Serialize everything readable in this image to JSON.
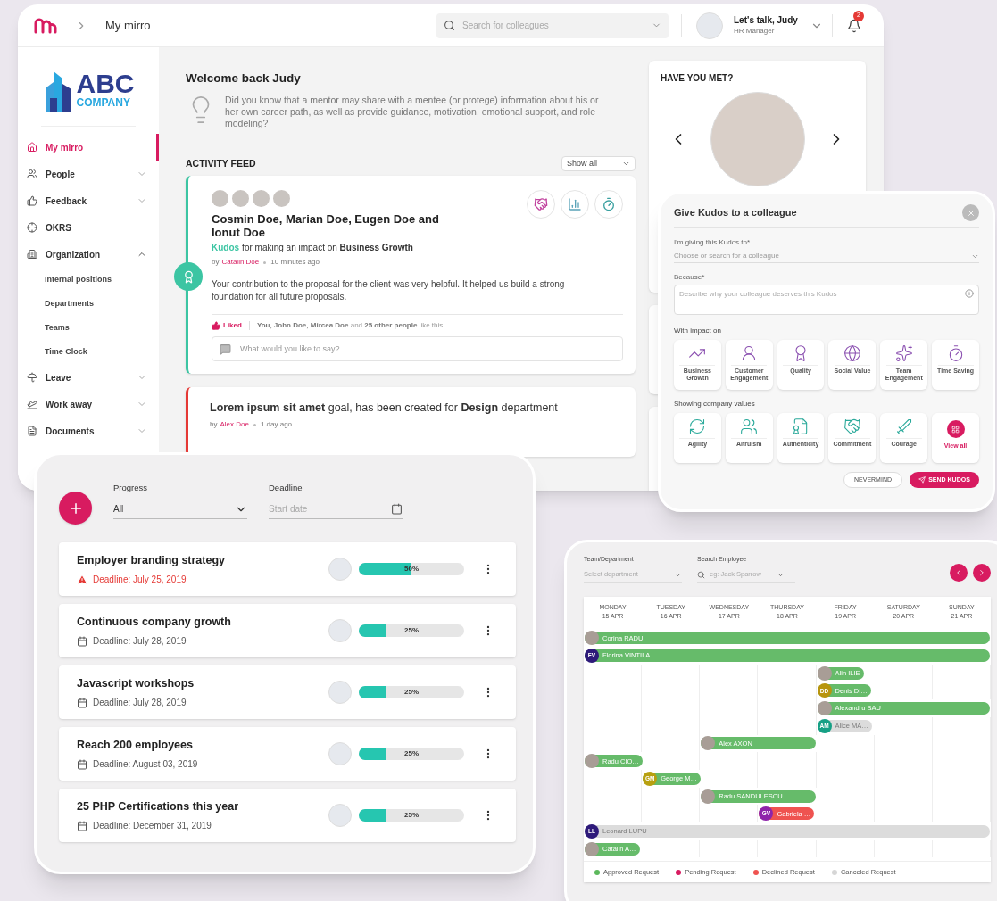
{
  "main_window": {
    "topbar": {
      "breadcrumb": "My mirro",
      "search": {
        "placeholder": "Search for colleagues"
      },
      "user": {
        "name": "Let's talk, Judy",
        "role": "HR Manager"
      },
      "notifications": "2"
    },
    "sidebar": {
      "logo": {
        "name": "ABC",
        "sub": "COMPANY"
      },
      "items": [
        {
          "label": "My mirro",
          "selected": true
        },
        {
          "label": "People",
          "selected": false,
          "expanded": false
        },
        {
          "label": "Feedback",
          "selected": false,
          "expanded": false
        },
        {
          "label": "OKRS",
          "selected": false
        },
        {
          "label": "Organization",
          "selected": false,
          "expanded": true,
          "children": [
            {
              "label": "Internal positions",
              "selected": false
            },
            {
              "label": "Departments",
              "selected": false
            },
            {
              "label": "Teams",
              "selected": false
            },
            {
              "label": "Time Clock",
              "selected": false
            }
          ]
        },
        {
          "label": "Leave",
          "selected": false,
          "expanded": false
        },
        {
          "label": "Work away",
          "selected": false,
          "expanded": false
        },
        {
          "label": "Documents",
          "selected": false,
          "expanded": false
        }
      ]
    },
    "welcome": {
      "title": "Welcome back Judy",
      "tip": "Did you know that a mentor may share with a mentee (or protege) information about his or her own career path, as well as provide guidance, motivation, emotional support, and role modeling?"
    },
    "feed": {
      "title": "ACTIVITY FEED",
      "filter": "Show all",
      "posts": [
        {
          "kind": "kudos",
          "people": "Cosmin Doe, Marian Doe, Eugen Doe and Ionut Doe",
          "tag": "Kudos",
          "text": "for making an impact on **Business Growth**",
          "by": "by",
          "author": "Catalin Doe",
          "time": "10 minutes ago",
          "message": "Your contribution to the proposal for the client was very helpful. It helped us build a strong foundation for all future proposals.",
          "liked": true,
          "like_label": "Liked",
          "likes": "**You, John Doe, Mircea Doe** and **25 other people** like this",
          "comment_placeholder": "What would you like to say?"
        },
        {
          "kind": "goal",
          "title": "**Lorem ipsum sit amet** goal, has been created for **Design** department",
          "by": "by",
          "author": "Alex Doe",
          "time": "1 day ago"
        }
      ]
    },
    "have_you_met": {
      "title": "HAVE YOU MET?"
    }
  },
  "kudos_dialog": {
    "title": "Give Kudos to a colleague",
    "recipient": {
      "label": "I'm giving this Kudos to*",
      "placeholder": "Choose or search for a colleague"
    },
    "reason": {
      "label": "Because*",
      "placeholder": "Describe why your colleague deserves this Kudos"
    },
    "impact_title": "With impact on",
    "impacts": [
      "Business Growth",
      "Customer Engagement",
      "Quality",
      "Social Value",
      "Team Engagement",
      "Time Saving"
    ],
    "values_title": "Showing company values",
    "values": [
      "Agility",
      "Altruism",
      "Authenticity",
      "Commitment",
      "Courage"
    ],
    "view_all": "View all",
    "cancel": "NEVERMIND",
    "send": "SEND KUDOS"
  },
  "goals_panel": {
    "progress_filter": {
      "label": "Progress",
      "value": "All"
    },
    "deadline_filter": {
      "label": "Deadline",
      "placeholder": "Start date"
    },
    "goals": [
      {
        "title": "Employer branding strategy",
        "deadline": "Deadline: July 25, 2019",
        "overdue": true,
        "level": 0.5,
        "reading": "50%"
      },
      {
        "title": "Continuous company growth",
        "deadline": "Deadline: July 28, 2019",
        "overdue": false,
        "level": 0.25,
        "reading": "25%"
      },
      {
        "title": "Javascript workshops",
        "deadline": "Deadline: July 28, 2019",
        "overdue": false,
        "level": 0.25,
        "reading": "25%"
      },
      {
        "title": "Reach 200 employees",
        "deadline": "Deadline: August 03, 2019",
        "overdue": false,
        "level": 0.25,
        "reading": "25%"
      },
      {
        "title": "25 PHP Certifications this year",
        "deadline": "Deadline: December 31, 2019",
        "overdue": false,
        "level": 0.25,
        "reading": "25%"
      }
    ]
  },
  "calendar": {
    "team_filter": {
      "label": "Team/Department",
      "placeholder": "Select department"
    },
    "employee_filter": {
      "label": "Search Employee",
      "placeholder": "eg: Jack Sparrow"
    },
    "days": [
      {
        "day": "MONDAY",
        "date": "15 APR"
      },
      {
        "day": "TUESDAY",
        "date": "16 APR"
      },
      {
        "day": "WEDNESDAY",
        "date": "17 APR"
      },
      {
        "day": "THURSDAY",
        "date": "18 APR"
      },
      {
        "day": "FRIDAY",
        "date": "19 APR"
      },
      {
        "day": "SATURDAY",
        "date": "20 APR"
      },
      {
        "day": "SUNDAY",
        "date": "21 APR"
      }
    ],
    "requests": [
      {
        "name": "Corina RADU",
        "avatar": {
          "kind": "photo"
        },
        "kind": "approved",
        "days": [
          true,
          true,
          true,
          true,
          true,
          true,
          true
        ]
      },
      {
        "name": "Florina VINTILA",
        "avatar": {
          "kind": "initials",
          "text": "FV",
          "color": "#2e1a7a"
        },
        "kind": "approved",
        "days": [
          true,
          true,
          true,
          true,
          true,
          true,
          true
        ]
      },
      {
        "name": "Alin ILIE",
        "avatar": {
          "kind": "photo"
        },
        "kind": "approved",
        "days": [
          false,
          false,
          false,
          false,
          true,
          false,
          false
        ]
      },
      {
        "name": "Denis DI…",
        "avatar": {
          "kind": "initials",
          "text": "DD",
          "color": "#b8950f"
        },
        "kind": "approved",
        "days": [
          false,
          false,
          false,
          false,
          true,
          false,
          false
        ]
      },
      {
        "name": "Alexandru BAU",
        "avatar": {
          "kind": "photo"
        },
        "kind": "approved",
        "days": [
          false,
          false,
          false,
          false,
          true,
          true,
          true
        ]
      },
      {
        "name": "Alice MA…",
        "avatar": {
          "kind": "initials",
          "text": "AM",
          "color": "#16a085"
        },
        "kind": "canceled",
        "days": [
          false,
          false,
          false,
          false,
          true,
          false,
          false
        ]
      },
      {
        "name": "Alex AXON",
        "avatar": {
          "kind": "photo"
        },
        "kind": "approved",
        "days": [
          false,
          false,
          true,
          true,
          false,
          false,
          false
        ]
      },
      {
        "name": "Radu CIO…",
        "avatar": {
          "kind": "photo"
        },
        "kind": "approved",
        "days": [
          true,
          false,
          false,
          false,
          false,
          false,
          false
        ]
      },
      {
        "name": "George M…",
        "avatar": {
          "kind": "initials",
          "text": "GM",
          "color": "#b8a010"
        },
        "kind": "approved",
        "days": [
          false,
          true,
          false,
          false,
          false,
          false,
          false
        ]
      },
      {
        "name": "Radu SANDULESCU",
        "avatar": {
          "kind": "photo"
        },
        "kind": "approved",
        "days": [
          false,
          false,
          true,
          true,
          false,
          false,
          false
        ]
      },
      {
        "name": "Gabriela …",
        "avatar": {
          "kind": "initials",
          "text": "GV",
          "color": "#8e24aa"
        },
        "kind": "declined",
        "days": [
          false,
          false,
          false,
          true,
          false,
          false,
          false
        ]
      },
      {
        "name": "Leonard LUPU",
        "avatar": {
          "kind": "initials",
          "text": "LL",
          "color": "#2e1a7a"
        },
        "kind": "canceled",
        "days": [
          true,
          true,
          true,
          true,
          true,
          true,
          true
        ]
      },
      {
        "name": "Catalin A…",
        "avatar": {
          "kind": "photo"
        },
        "kind": "approved",
        "days": [
          true,
          false,
          false,
          false,
          false,
          false,
          false
        ]
      }
    ],
    "legend": [
      {
        "label": "Approved Request",
        "color": "#5cb85c"
      },
      {
        "label": "Pending Request",
        "color": "#d81b60"
      },
      {
        "label": "Declined Request",
        "color": "#ef5350"
      },
      {
        "label": "Canceled Request",
        "color": "#d6d6d6"
      }
    ]
  }
}
